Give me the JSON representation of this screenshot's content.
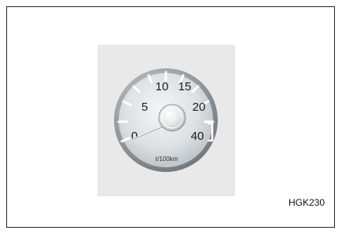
{
  "figure": {
    "code": "HGK230"
  },
  "gauge": {
    "type": "fuel consumption gauge",
    "scale_labels": [
      "0",
      "5",
      "10",
      "15",
      "20",
      "40"
    ],
    "unit": "ℓ/100km",
    "needle_value": 0,
    "colors": {
      "panel": "#e9e9e9",
      "bezel": "#9aa0a6",
      "dial": "#dfe3e6",
      "ticks": "#ffffff",
      "numbers": "#1a1a1a"
    }
  }
}
